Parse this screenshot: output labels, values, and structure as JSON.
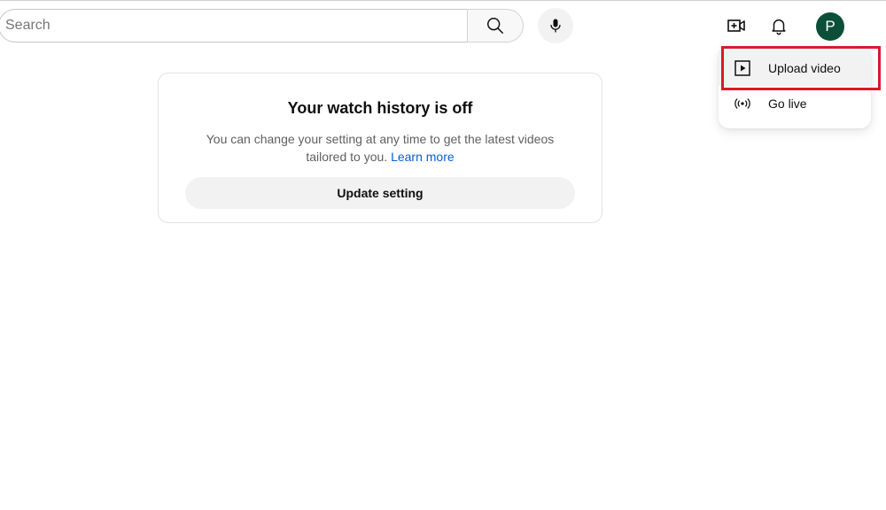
{
  "header": {
    "search": {
      "placeholder": "Search",
      "value": ""
    },
    "search_button_icon": "search-icon",
    "mic_button_icon": "microphone-icon",
    "create_button_icon": "video-camera-plus-icon",
    "notifications_icon": "bell-icon",
    "avatar_initial": "P",
    "avatar_color": "#0b4f38"
  },
  "create_menu": {
    "items": [
      {
        "label": "Upload video",
        "icon": "upload-video-icon",
        "highlighted": true
      },
      {
        "label": "Go live",
        "icon": "go-live-icon",
        "highlighted": false
      }
    ],
    "highlight_color": "#d91a2a"
  },
  "history_card": {
    "title": "Your watch history is off",
    "description": "You can change your setting at any time to get the latest videos tailored to you.",
    "link_label": "Learn more",
    "link_color": "#065fd4",
    "button_label": "Update setting"
  }
}
